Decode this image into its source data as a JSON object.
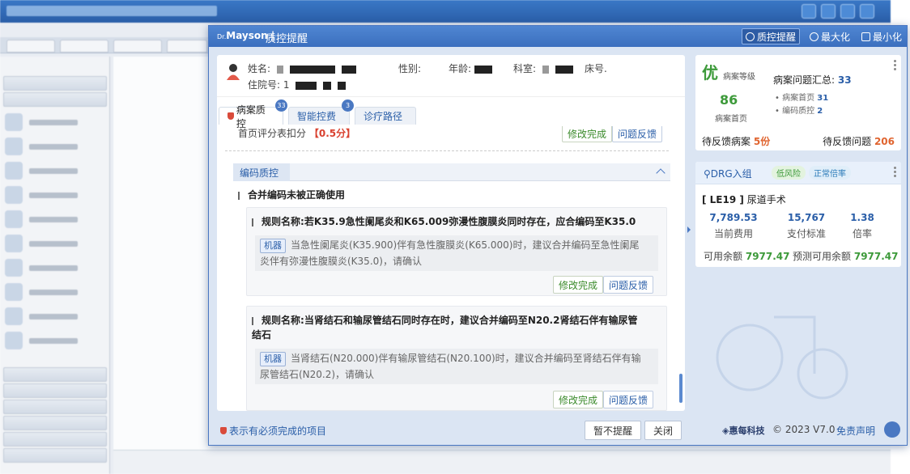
{
  "dialog": {
    "logo": "Mayson",
    "logo_prefix": "Dr.",
    "title": "质控提醒",
    "header_buttons": {
      "qc": "质控提醒",
      "max": "最大化",
      "min": "最小化"
    }
  },
  "patient": {
    "name_label": "姓名:",
    "gender_label": "性别:",
    "age_label": "年龄:",
    "dept_label": "科室:",
    "bed_label": "床号.",
    "inpatient_label": "住院号:",
    "inpatient_value": "1"
  },
  "tabs": [
    {
      "label": "病案质控",
      "badge": "33"
    },
    {
      "label": "智能控费",
      "badge": "3"
    },
    {
      "label": "诊疗路径",
      "badge": ""
    }
  ],
  "score": {
    "label": "首页评分表扣分",
    "value": "【0.5分】"
  },
  "actions": {
    "done": "修改完成",
    "feedback": "问题反馈"
  },
  "section": {
    "title": "编码质控"
  },
  "group": {
    "title": "合并编码未被正确使用"
  },
  "rules": [
    {
      "name_label": "规则名称:",
      "name": "若K35.9急性阑尾炎和K65.009弥漫性腹膜炎同时存在，应合编码至K35.0",
      "tag": "机器",
      "desc_line1": "当急性阑尾炎(K35.900)伴有急性腹膜炎(K65.000)时，建议合并编码至急性阑尾",
      "desc_line2": "炎伴有弥漫性腹膜炎(K35.0)，请确认"
    },
    {
      "name_label": "规则名称:",
      "name_line1": "当肾结石和输尿管结石同时存在时，建议合并编码至N20.2肾结石伴有输尿管",
      "name_line2": "结石",
      "tag": "机器",
      "desc_line1": "当肾结石(N20.000)伴有输尿管结石(N20.100)时，建议合并编码至肾结石伴有输",
      "desc_line2": "尿管结石(N20.2)，请确认"
    }
  ],
  "summary": {
    "grade": "优",
    "grade_label": "病案等级",
    "score": "86",
    "score_label": "病案首页",
    "total_label": "病案问题汇总:",
    "total": "33",
    "items": [
      {
        "label": "病案首页",
        "value": "31"
      },
      {
        "label": "编码质控",
        "value": "2"
      }
    ],
    "pending_cases_label": "待反馈病案",
    "pending_cases": "5份",
    "pending_issues_label": "待反馈问题",
    "pending_issues": "206"
  },
  "drg": {
    "title": "DRG入组",
    "risk_low": "低风险",
    "risk_status": "正常倍率",
    "code": "[ LE19 ]",
    "name": "尿道手术",
    "metrics": [
      {
        "value": "7,789.53",
        "label": "当前费用"
      },
      {
        "value": "15,767",
        "label": "支付标准"
      },
      {
        "value": "1.38",
        "label": "倍率"
      }
    ],
    "available_label": "可用余额",
    "available": "7977.47",
    "forecast_label": "预测可用余额",
    "forecast": "7977.47"
  },
  "footer": {
    "note": "表示有必须完成的项目",
    "snooze": "暂不提醒",
    "close": "关闭",
    "brand": "惠每科技",
    "copyright": "© 2023 V7.0",
    "disclaimer": "免责声明"
  },
  "colors": {
    "primary": "#4a78c2",
    "green": "#3d9a3a",
    "red": "#d9412f",
    "orange": "#e0642f"
  }
}
